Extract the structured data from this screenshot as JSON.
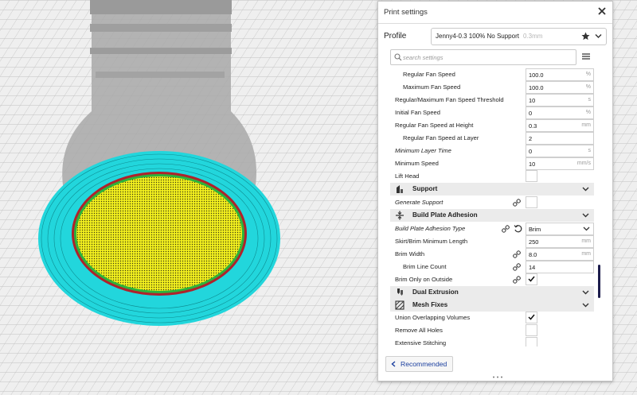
{
  "panel": {
    "title": "Print settings",
    "profile_label": "Profile",
    "profile_name": "Jenny4-0.3 100% No Support",
    "profile_layer": "0.3mm",
    "search_placeholder": "search settings",
    "recommended_label": "Recommended"
  },
  "settings": {
    "fan_speed": {
      "label": "Regular Fan Speed",
      "value": "100.0",
      "unit": "%"
    },
    "max_fan_speed": {
      "label": "Maximum Fan Speed",
      "value": "100.0",
      "unit": "%"
    },
    "fan_threshold": {
      "label": "Regular/Maximum Fan Speed Threshold",
      "value": "10",
      "unit": "s"
    },
    "initial_fan": {
      "label": "Initial Fan Speed",
      "value": "0",
      "unit": "%"
    },
    "fan_height": {
      "label": "Regular Fan Speed at Height",
      "value": "0.3",
      "unit": "mm"
    },
    "fan_layer": {
      "label": "Regular Fan Speed at Layer",
      "value": "2",
      "unit": ""
    },
    "min_layer_time": {
      "label": "Minimum Layer Time",
      "value": "0",
      "unit": "s"
    },
    "min_speed": {
      "label": "Minimum Speed",
      "value": "10",
      "unit": "mm/s"
    },
    "lift_head": {
      "label": "Lift Head",
      "checked": false
    },
    "support_cat": {
      "label": "Support"
    },
    "generate_support": {
      "label": "Generate Support",
      "checked": false
    },
    "adhesion_cat": {
      "label": "Build Plate Adhesion"
    },
    "adhesion_type": {
      "label": "Build Plate Adhesion Type",
      "value": "Brim"
    },
    "skirt_min_len": {
      "label": "Skirt/Brim Minimum Length",
      "value": "250",
      "unit": "mm"
    },
    "brim_width": {
      "label": "Brim Width",
      "value": "8.0",
      "unit": "mm"
    },
    "brim_line_count": {
      "label": "Brim Line Count",
      "value": "14",
      "unit": ""
    },
    "brim_outside": {
      "label": "Brim Only on Outside",
      "checked": true
    },
    "dual_cat": {
      "label": "Dual Extrusion"
    },
    "mesh_cat": {
      "label": "Mesh Fixes"
    },
    "union_volumes": {
      "label": "Union Overlapping Volumes",
      "checked": true
    },
    "remove_holes": {
      "label": "Remove All Holes",
      "checked": false
    },
    "ext_stitching": {
      "label": "Extensive Stitching",
      "checked": false
    }
  },
  "colors": {
    "brim": "#22d6dc",
    "top_layer": "#f2ef1e",
    "model": "#a8a8a8",
    "accent": "#1a3e9e"
  }
}
